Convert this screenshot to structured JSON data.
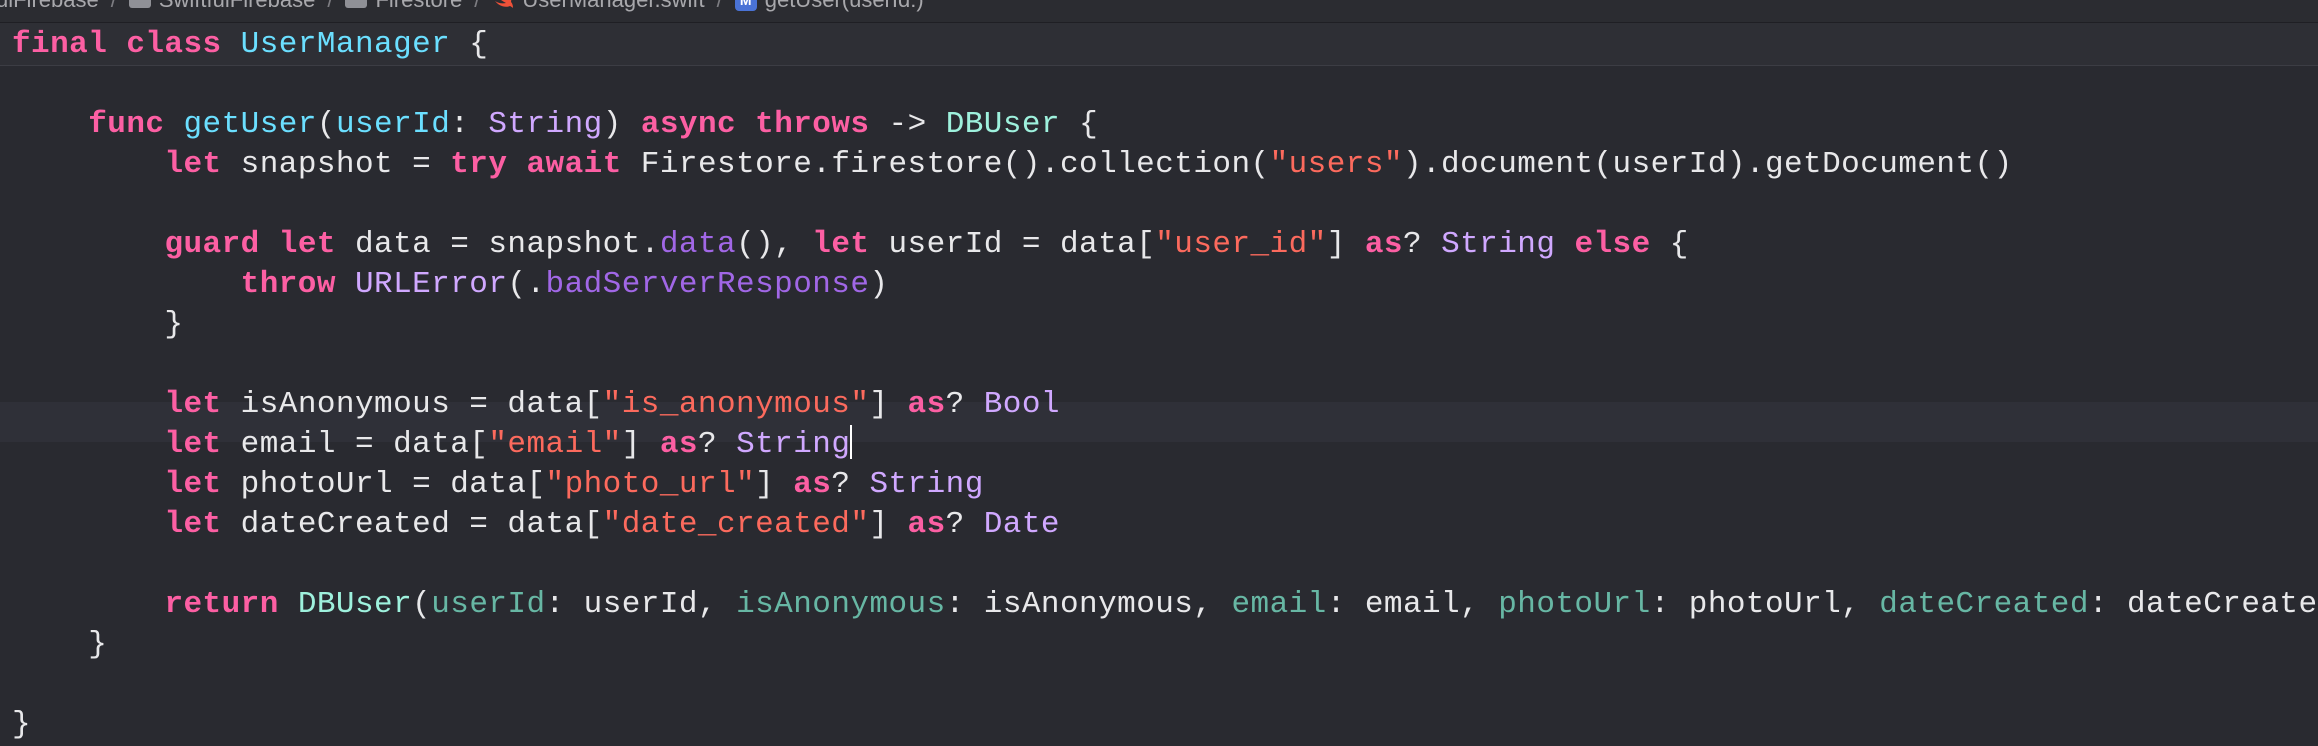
{
  "jumpbar": {
    "crumbs": [
      "uiFirebase",
      "SwiftfulFirebase",
      "Firestore",
      "UserManager.swift",
      "getUser(userId:)"
    ],
    "separator": "/"
  },
  "editor": {
    "lines": [
      [
        [
          "kw",
          "final"
        ],
        [
          "plain",
          " "
        ],
        [
          "kw",
          "class"
        ],
        [
          "plain",
          " "
        ],
        [
          "decl",
          "UserManager"
        ],
        [
          "plain",
          " {"
        ]
      ],
      [],
      [
        [
          "plain",
          "    "
        ],
        [
          "kw",
          "func"
        ],
        [
          "plain",
          " "
        ],
        [
          "decl",
          "getUser"
        ],
        [
          "plain",
          "("
        ],
        [
          "decl",
          "userId"
        ],
        [
          "plain",
          ": "
        ],
        [
          "type",
          "String"
        ],
        [
          "plain",
          ") "
        ],
        [
          "kw",
          "async"
        ],
        [
          "plain",
          " "
        ],
        [
          "kw",
          "throws"
        ],
        [
          "plain",
          " -> "
        ],
        [
          "user-type",
          "DBUser"
        ],
        [
          "plain",
          " {"
        ]
      ],
      [
        [
          "plain",
          "        "
        ],
        [
          "kw",
          "let"
        ],
        [
          "plain",
          " snapshot = "
        ],
        [
          "kw",
          "try"
        ],
        [
          "plain",
          " "
        ],
        [
          "kw",
          "await"
        ],
        [
          "plain",
          " Firestore.firestore().collection("
        ],
        [
          "str",
          "\"users\""
        ],
        [
          "plain",
          ").document(userId).getDocument()"
        ]
      ],
      [],
      [
        [
          "plain",
          "        "
        ],
        [
          "kw",
          "guard"
        ],
        [
          "plain",
          " "
        ],
        [
          "kw",
          "let"
        ],
        [
          "plain",
          " data = snapshot."
        ],
        [
          "member",
          "data"
        ],
        [
          "plain",
          "(), "
        ],
        [
          "kw",
          "let"
        ],
        [
          "plain",
          " userId = data["
        ],
        [
          "str",
          "\"user_id\""
        ],
        [
          "plain",
          "] "
        ],
        [
          "kw",
          "as"
        ],
        [
          "plain",
          "? "
        ],
        [
          "type",
          "String"
        ],
        [
          "plain",
          " "
        ],
        [
          "kw",
          "else"
        ],
        [
          "plain",
          " {"
        ]
      ],
      [
        [
          "plain",
          "            "
        ],
        [
          "kw",
          "throw"
        ],
        [
          "plain",
          " "
        ],
        [
          "type",
          "URLError"
        ],
        [
          "plain",
          "(."
        ],
        [
          "member",
          "badServerResponse"
        ],
        [
          "plain",
          ")"
        ]
      ],
      [
        [
          "plain",
          "        }"
        ]
      ],
      [],
      [
        [
          "plain",
          "        "
        ],
        [
          "kw",
          "let"
        ],
        [
          "plain",
          " isAnonymous = data["
        ],
        [
          "str",
          "\"is_anonymous\""
        ],
        [
          "plain",
          "] "
        ],
        [
          "kw",
          "as"
        ],
        [
          "plain",
          "? "
        ],
        [
          "type",
          "Bool"
        ]
      ],
      [
        [
          "plain",
          "        "
        ],
        [
          "kw",
          "let"
        ],
        [
          "plain",
          " email = data["
        ],
        [
          "str",
          "\"email\""
        ],
        [
          "plain",
          "] "
        ],
        [
          "kw",
          "as"
        ],
        [
          "plain",
          "? "
        ],
        [
          "type",
          "String"
        ],
        [
          "cursor",
          ""
        ]
      ],
      [
        [
          "plain",
          "        "
        ],
        [
          "kw",
          "let"
        ],
        [
          "plain",
          " photoUrl = data["
        ],
        [
          "str",
          "\"photo_url\""
        ],
        [
          "plain",
          "] "
        ],
        [
          "kw",
          "as"
        ],
        [
          "plain",
          "? "
        ],
        [
          "type",
          "String"
        ]
      ],
      [
        [
          "plain",
          "        "
        ],
        [
          "kw",
          "let"
        ],
        [
          "plain",
          " dateCreated = data["
        ],
        [
          "str",
          "\"date_created\""
        ],
        [
          "plain",
          "] "
        ],
        [
          "kw",
          "as"
        ],
        [
          "plain",
          "? "
        ],
        [
          "type",
          "Date"
        ]
      ],
      [],
      [
        [
          "plain",
          "        "
        ],
        [
          "kw",
          "return"
        ],
        [
          "plain",
          " "
        ],
        [
          "user-type",
          "DBUser"
        ],
        [
          "plain",
          "("
        ],
        [
          "param",
          "userId"
        ],
        [
          "plain",
          ": userId, "
        ],
        [
          "param",
          "isAnonymous"
        ],
        [
          "plain",
          ": isAnonymous, "
        ],
        [
          "param",
          "email"
        ],
        [
          "plain",
          ": email, "
        ],
        [
          "param",
          "photoUrl"
        ],
        [
          "plain",
          ": photoUrl, "
        ],
        [
          "param",
          "dateCreated"
        ],
        [
          "plain",
          ": dateCreated)"
        ]
      ],
      [
        [
          "plain",
          "    }"
        ]
      ],
      [],
      [
        [
          "plain",
          "}"
        ]
      ]
    ]
  },
  "colors": {
    "background": "#292a30",
    "keyword": "#fc5fa3",
    "type": "#d0a8ff",
    "declaration": "#6bdfff",
    "user_type": "#9ef1dd",
    "string": "#fc6a5d",
    "parameter": "#67b7a4",
    "member": "#a167e6",
    "plain": "#e8e8ea"
  }
}
